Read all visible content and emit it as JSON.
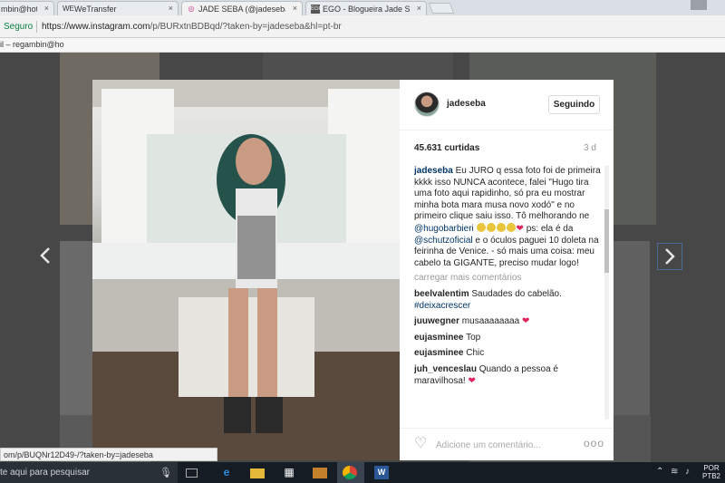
{
  "tabs": [
    {
      "favicon": "",
      "label": "mbin@hotm",
      "close": "×"
    },
    {
      "favicon": "WE",
      "label": "WeTransfer",
      "close": "×"
    },
    {
      "favicon": "◎",
      "label": "JADE SEBA (@jadeseba)",
      "close": "×"
    },
    {
      "favicon": "EGO",
      "label": "EGO - Blogueira Jade Se",
      "close": "×"
    }
  ],
  "address_bar": {
    "secure_label": "Seguro",
    "url_host": "https://www.instagram.com",
    "url_path": "/p/BURxtnBDBqd/?taken-by=jadeseba&hl=pt-br"
  },
  "bookmarks": {
    "email_item": "il – regambin@ho"
  },
  "post": {
    "username": "jadeseba",
    "follow_label": "Seguindo",
    "likes": "45.631 curtidas",
    "age": "3 d",
    "caption": {
      "author": "jadeseba",
      "text_1": "Eu JURO q essa foto foi de primeira kkkk isso NUNCA acontece, falei \"Hugo tira uma foto aqui rapidinho, só pra eu mostrar minha bota mara musa novo xodó\" e no primeiro clique saiu isso. Tô melhorando ne",
      "mention_1": "@hugobarbieri",
      "text_2": "ps: ela é da",
      "mention_2": "@schutzoficial",
      "text_3": "e o óculos paguei 10 doleta na feirinha de Venice. - só mais uma coisa: meu cabelo ta GIGANTE, preciso mudar logo!"
    },
    "load_more": "carregar mais comentários",
    "comments": [
      {
        "user": "beelvalentim",
        "text": "Saudades do cabelão.",
        "tag": "#deixacrescer"
      },
      {
        "user": "juuwegner",
        "text": "musaaaaaaaa",
        "tag": ""
      },
      {
        "user": "eujasminee",
        "text": "Top",
        "tag": ""
      },
      {
        "user": "eujasminee",
        "text": "Chic",
        "tag": ""
      },
      {
        "user": "juh_venceslau",
        "text": "Quando a pessoa é maravilhosa!",
        "tag": ""
      }
    ],
    "comment_placeholder": "Adicione um comentário...",
    "more_label": "ooo"
  },
  "status_link": "om/p/BUQNr12D49-/?taken-by=jadeseba",
  "taskbar": {
    "search_text": "te aqui para pesquisar",
    "lang_1": "POR",
    "lang_2": "PTB2"
  },
  "icons": {
    "prev": "chevron-left-icon",
    "next": "chevron-right-icon",
    "like": "heart-outline-icon"
  }
}
